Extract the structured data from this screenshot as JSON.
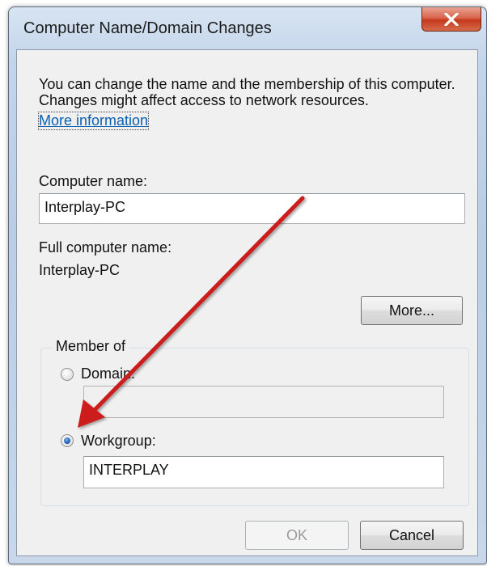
{
  "window": {
    "title": "Computer Name/Domain Changes",
    "close_glyph": "x"
  },
  "intro": {
    "description": "You can change the name and the membership of this computer. Changes might affect access to network resources.",
    "more_info_link": "More information"
  },
  "computer_name": {
    "label": "Computer name:",
    "value": "Interplay-PC"
  },
  "full_name": {
    "label": "Full computer name:",
    "value": "Interplay-PC"
  },
  "more_button": {
    "label": "More..."
  },
  "member_of": {
    "title": "Member of",
    "domain": {
      "label": "Domain:",
      "value": "",
      "selected": false
    },
    "workgroup": {
      "label": "Workgroup:",
      "value": "INTERPLAY",
      "selected": true
    }
  },
  "buttons": {
    "ok": "OK",
    "cancel": "Cancel"
  },
  "annotation": {
    "arrow_color": "#cc1f1a"
  }
}
